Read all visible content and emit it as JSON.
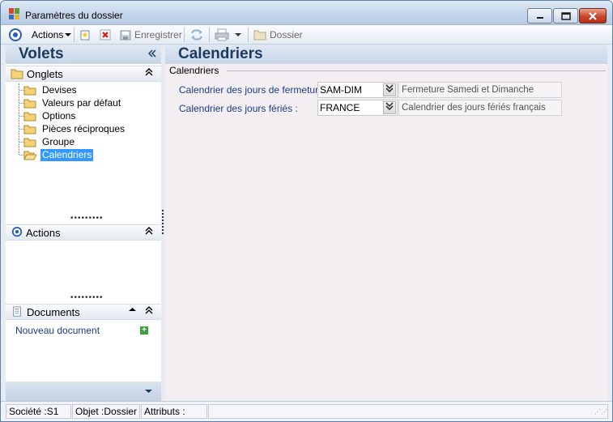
{
  "window": {
    "title": "Paramètres du dossier"
  },
  "toolbar": {
    "actions_label": "Actions",
    "save_label": "Enregistrer",
    "folder_label": "Dossier"
  },
  "left_pane": {
    "title": "Volets",
    "onglets": {
      "title": "Onglets",
      "items": [
        {
          "label": "Devises"
        },
        {
          "label": "Valeurs par défaut"
        },
        {
          "label": "Options"
        },
        {
          "label": "Pièces réciproques"
        },
        {
          "label": "Groupe"
        },
        {
          "label": "Calendriers",
          "selected": true
        }
      ]
    },
    "actions": {
      "title": "Actions"
    },
    "documents": {
      "title": "Documents",
      "new_document": "Nouveau document"
    }
  },
  "main": {
    "title": "Calendriers",
    "group_label": "Calendriers",
    "fields": [
      {
        "label": "Calendrier des jours de fermeture :",
        "value": "SAM-DIM",
        "description": "Fermeture Samedi et  Dimanche"
      },
      {
        "label": "Calendrier des jours fériés :",
        "value": "FRANCE",
        "description": "Calendrier des jours fériés français"
      }
    ]
  },
  "status_bar": {
    "societe": "Société :S1",
    "objet": "Objet :Dossier",
    "attributs": "Attributs :"
  },
  "icons": {
    "app": "app-icon",
    "minimize": "minimize-icon",
    "maximize": "maximize-icon",
    "close": "close-icon",
    "actions": "actions-icon",
    "new": "new-icon",
    "delete": "delete-icon",
    "save": "save-icon",
    "refresh": "refresh-icon",
    "print": "print-icon",
    "folder": "folder-icon"
  },
  "colors": {
    "selection": "#3399ff",
    "header_text": "#1e3a5f",
    "link": "#1f3b88"
  }
}
